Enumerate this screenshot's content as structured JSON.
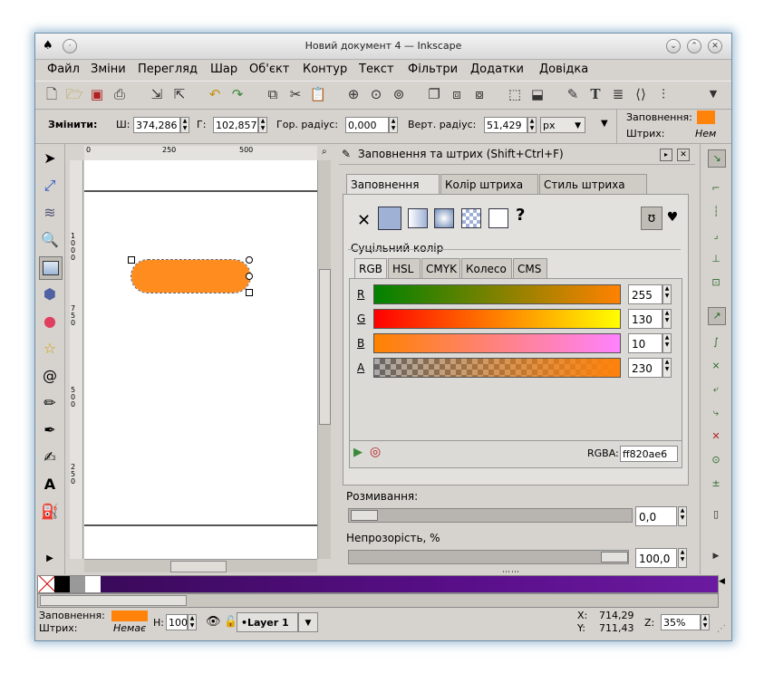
{
  "window": {
    "title": "Новий документ 4 — Inkscape"
  },
  "menu": [
    "Файл",
    "Зміни",
    "Перегляд",
    "Шар",
    "Об'єкт",
    "Контур",
    "Текст",
    "Фільтри",
    "Додатки",
    "Довідка"
  ],
  "controls": {
    "change_label": "Змінити:",
    "w_label": "Ш:",
    "w_value": "374,286",
    "h_label": "Г:",
    "h_value": "102,857",
    "hr_label": "Гор. радіус:",
    "hr_value": "0,000",
    "vr_label": "Верт. радіус:",
    "vr_value": "51,429",
    "unit": "px",
    "fill_label": "Заповнення:",
    "stroke_label": "Штрих:",
    "stroke_value": "Нем"
  },
  "ruler": {
    "h_ticks": [
      "0",
      "250",
      "500"
    ],
    "v_ticks": [
      "1000",
      "750",
      "500",
      "250"
    ]
  },
  "dialog": {
    "title": "Заповнення та штрих (Shift+Ctrl+F)",
    "tabs": [
      "Заповнення",
      "Колір штриха",
      "Стиль штриха"
    ],
    "flat_color_label": "Суцільний колір",
    "color_tabs": [
      "RGB",
      "HSL",
      "CMYK",
      "Колесо",
      "CMS"
    ],
    "channels": [
      {
        "label": "R",
        "value": "255"
      },
      {
        "label": "G",
        "value": "130"
      },
      {
        "label": "B",
        "value": "10"
      },
      {
        "label": "A",
        "value": "230"
      }
    ],
    "rgba_label": "RGBA:",
    "rgba_value": "ff820ae6",
    "blur_label": "Розмивання:",
    "blur_value": "0,0",
    "opacity_label": "Непрозорість, %",
    "opacity_value": "100,0"
  },
  "status": {
    "fill_label": "Заповнення:",
    "stroke_label": "Штрих:",
    "stroke_value": "Немає",
    "h_label": "Н:",
    "h_value": "100",
    "layer": "•Layer 1",
    "x_label": "X:",
    "x_value": "714,29",
    "y_label": "Y:",
    "y_value": "711,43",
    "zoom_label": "Z:",
    "zoom_value": "35%"
  },
  "colors": {
    "fill": "#ff820a",
    "accent_purple": "#5a0f8a"
  }
}
